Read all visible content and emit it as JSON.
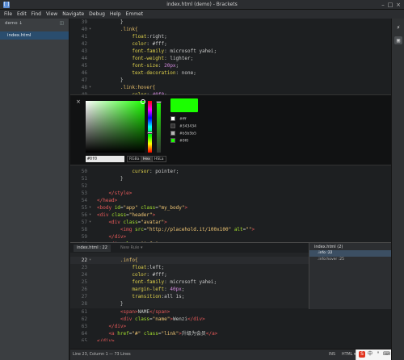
{
  "window": {
    "title": "index.html (demo) - Brackets"
  },
  "menu": [
    "File",
    "Edit",
    "Find",
    "View",
    "Navigate",
    "Debug",
    "Help",
    "Emmet"
  ],
  "sidebar": {
    "project": "demo ↓",
    "file": "index.html"
  },
  "editor_top": [
    {
      "n": "39",
      "fold": "",
      "code": [
        [
          "c-pl",
          "        }"
        ]
      ]
    },
    {
      "n": "40",
      "fold": "▾",
      "code": [
        [
          "c-sel",
          "        .link{"
        ]
      ]
    },
    {
      "n": "41",
      "fold": "",
      "code": [
        [
          "c-prop",
          "            float"
        ],
        [
          "c-pl",
          ":"
        ],
        [
          "c-val",
          "right"
        ],
        [
          "c-pl",
          ";"
        ]
      ]
    },
    {
      "n": "42",
      "fold": "",
      "code": [
        [
          "c-prop",
          "            color"
        ],
        [
          "c-pl",
          ": "
        ],
        [
          "c-val",
          "#fff"
        ],
        [
          "c-pl",
          ";"
        ]
      ]
    },
    {
      "n": "43",
      "fold": "",
      "code": [
        [
          "c-prop",
          "            font-family"
        ],
        [
          "c-pl",
          ": "
        ],
        [
          "c-val",
          "microsoft yahei"
        ],
        [
          "c-pl",
          ";"
        ]
      ]
    },
    {
      "n": "44",
      "fold": "",
      "code": [
        [
          "c-prop",
          "            font-weight"
        ],
        [
          "c-pl",
          ": "
        ],
        [
          "c-val",
          "lighter"
        ],
        [
          "c-pl",
          ";"
        ]
      ]
    },
    {
      "n": "45",
      "fold": "",
      "code": [
        [
          "c-prop",
          "            font-size"
        ],
        [
          "c-pl",
          ": "
        ],
        [
          "c-num",
          "20px"
        ],
        [
          "c-pl",
          ";"
        ]
      ]
    },
    {
      "n": "46",
      "fold": "",
      "code": [
        [
          "c-prop",
          "            text-decoration"
        ],
        [
          "c-pl",
          ": "
        ],
        [
          "c-val",
          "none"
        ],
        [
          "c-pl",
          ";"
        ]
      ]
    },
    {
      "n": "47",
      "fold": "",
      "code": [
        [
          "c-pl",
          "        }"
        ]
      ]
    },
    {
      "n": "48",
      "fold": "▾",
      "code": [
        [
          "c-sel",
          "        .link:hover{"
        ]
      ]
    },
    {
      "n": "49",
      "fold": "",
      "code": [
        [
          "c-prop",
          "            color"
        ],
        [
          "c-pl",
          ": "
        ],
        [
          "c-num",
          "#0f0"
        ],
        [
          "c-pl",
          ";"
        ]
      ]
    }
  ],
  "editor_mid": [
    {
      "n": "50",
      "fold": "",
      "code": [
        [
          "c-prop",
          "            cursor"
        ],
        [
          "c-pl",
          ": "
        ],
        [
          "c-val",
          "pointer"
        ],
        [
          "c-pl",
          ";"
        ]
      ]
    },
    {
      "n": "51",
      "fold": "",
      "code": [
        [
          "c-pl",
          "        }"
        ]
      ]
    },
    {
      "n": "52",
      "fold": "",
      "code": [
        [
          "c-pl",
          ""
        ]
      ]
    },
    {
      "n": "53",
      "fold": "",
      "code": [
        [
          "c-tag",
          "    </style>"
        ]
      ]
    },
    {
      "n": "54",
      "fold": "",
      "code": [
        [
          "c-tag",
          "</head>"
        ]
      ]
    },
    {
      "n": "55",
      "fold": "▾",
      "code": [
        [
          "c-tag",
          "<body "
        ],
        [
          "c-attr",
          "id"
        ],
        [
          "c-pl",
          "="
        ],
        [
          "c-str",
          "\"app\" "
        ],
        [
          "c-attr",
          "class"
        ],
        [
          "c-pl",
          "="
        ],
        [
          "c-str",
          "\"my_body\""
        ],
        [
          "c-tag",
          ">"
        ]
      ]
    },
    {
      "n": "56",
      "fold": "▾",
      "code": [
        [
          "c-tag",
          "<div "
        ],
        [
          "c-attr",
          "class"
        ],
        [
          "c-pl",
          "="
        ],
        [
          "c-str",
          "\"header\""
        ],
        [
          "c-tag",
          ">"
        ]
      ]
    },
    {
      "n": "57",
      "fold": "▾",
      "code": [
        [
          "c-tag",
          "    <div "
        ],
        [
          "c-attr",
          "class"
        ],
        [
          "c-pl",
          "="
        ],
        [
          "c-str",
          "\"avatar\""
        ],
        [
          "c-tag",
          ">"
        ]
      ]
    },
    {
      "n": "58",
      "fold": "",
      "code": [
        [
          "c-tag",
          "        <img "
        ],
        [
          "c-attr",
          "src"
        ],
        [
          "c-pl",
          "="
        ],
        [
          "c-str",
          "\"http://placehold.it/100x100\" "
        ],
        [
          "c-attr",
          "alt"
        ],
        [
          "c-pl",
          "="
        ],
        [
          "c-str",
          "\"\""
        ],
        [
          "c-tag",
          ">"
        ]
      ]
    },
    {
      "n": "59",
      "fold": "",
      "code": [
        [
          "c-tag",
          "    </div>"
        ]
      ]
    },
    {
      "n": "60",
      "fold": "▾",
      "code": [
        [
          "c-tag",
          "    <div "
        ],
        [
          "c-attr",
          "class"
        ],
        [
          "c-pl",
          "="
        ],
        [
          "c-str",
          "\"info\""
        ],
        [
          "c-tag",
          ">"
        ]
      ]
    }
  ],
  "editor_bottom": [
    {
      "n": "61",
      "fold": "",
      "code": [
        [
          "c-tag",
          "        <span>"
        ],
        [
          "c-pl",
          "NAME"
        ],
        [
          "c-tag",
          "</span>"
        ]
      ]
    },
    {
      "n": "62",
      "fold": "",
      "code": [
        [
          "c-tag",
          "        <div "
        ],
        [
          "c-attr",
          "class"
        ],
        [
          "c-pl",
          "="
        ],
        [
          "c-str",
          "\"name\""
        ],
        [
          "c-tag",
          ">"
        ],
        [
          "c-pl",
          "Wenzi"
        ],
        [
          "c-tag",
          "</div>"
        ]
      ]
    },
    {
      "n": "63",
      "fold": "",
      "code": [
        [
          "c-tag",
          "    </div>"
        ]
      ]
    },
    {
      "n": "64",
      "fold": "",
      "code": [
        [
          "c-tag",
          "    <a "
        ],
        [
          "c-attr",
          "href"
        ],
        [
          "c-pl",
          "="
        ],
        [
          "c-str",
          "\"#\" "
        ],
        [
          "c-attr",
          "class"
        ],
        [
          "c-pl",
          "="
        ],
        [
          "c-str",
          "\"link\""
        ],
        [
          "c-tag",
          ">"
        ],
        [
          "c-pl",
          "升级为会员"
        ],
        [
          "c-tag",
          "</a>"
        ]
      ]
    },
    {
      "n": "65",
      "fold": "",
      "code": [
        [
          "c-tag",
          "</div>"
        ]
      ]
    },
    {
      "n": "66",
      "fold": "",
      "code": [
        [
          "c-tag",
          "<script>"
        ]
      ]
    }
  ],
  "inline_editor": {
    "tabs": [
      "index.html : 22",
      "New Rule ▾"
    ],
    "lines": [
      {
        "n": "22",
        "fold": "▾",
        "active": true,
        "code": [
          [
            "c-sel",
            "        .info{"
          ]
        ]
      },
      {
        "n": "23",
        "fold": "",
        "code": [
          [
            "c-prop",
            "            float"
          ],
          [
            "c-pl",
            ":"
          ],
          [
            "c-val",
            "left"
          ],
          [
            "c-pl",
            ";"
          ]
        ]
      },
      {
        "n": "24",
        "fold": "",
        "code": [
          [
            "c-prop",
            "            color"
          ],
          [
            "c-pl",
            ": "
          ],
          [
            "c-val",
            "#fff"
          ],
          [
            "c-pl",
            ";"
          ]
        ]
      },
      {
        "n": "25",
        "fold": "",
        "code": [
          [
            "c-prop",
            "            font-family"
          ],
          [
            "c-pl",
            ": "
          ],
          [
            "c-val",
            "microsoft yahei"
          ],
          [
            "c-pl",
            ";"
          ]
        ]
      },
      {
        "n": "26",
        "fold": "",
        "code": [
          [
            "c-prop",
            "            margin-left"
          ],
          [
            "c-pl",
            ": "
          ],
          [
            "c-num",
            "40px"
          ],
          [
            "c-pl",
            ";"
          ]
        ]
      },
      {
        "n": "27",
        "fold": "",
        "code": [
          [
            "c-prop",
            "            transition"
          ],
          [
            "c-pl",
            ":"
          ],
          [
            "c-val",
            "all 1s"
          ],
          [
            "c-pl",
            ";"
          ]
        ]
      },
      {
        "n": "28",
        "fold": "",
        "code": [
          [
            "c-pl",
            "        }"
          ]
        ]
      }
    ],
    "rules_header": "index.html (2)",
    "rules": [
      ".info :22",
      ".info:hover :25"
    ]
  },
  "color_picker": {
    "hex_value": "#0f0",
    "formats": [
      "RGBa",
      "Hex",
      "HSLa"
    ],
    "active_format": "Hex",
    "close": "×",
    "swatches": [
      {
        "label": "#fff",
        "color": "#ffffff"
      },
      {
        "label": "#343434",
        "color": "#343434"
      },
      {
        "label": "#b5b5b5",
        "color": "#b5b5b5"
      },
      {
        "label": "#0f0",
        "color": "#1bff00"
      }
    ],
    "current_color": "#1bff00"
  },
  "statusbar": {
    "position": "Line 23, Column 1 — 73 Lines",
    "ins": "INS",
    "language": "HTML ▾",
    "indent": "Spaces: 4"
  }
}
